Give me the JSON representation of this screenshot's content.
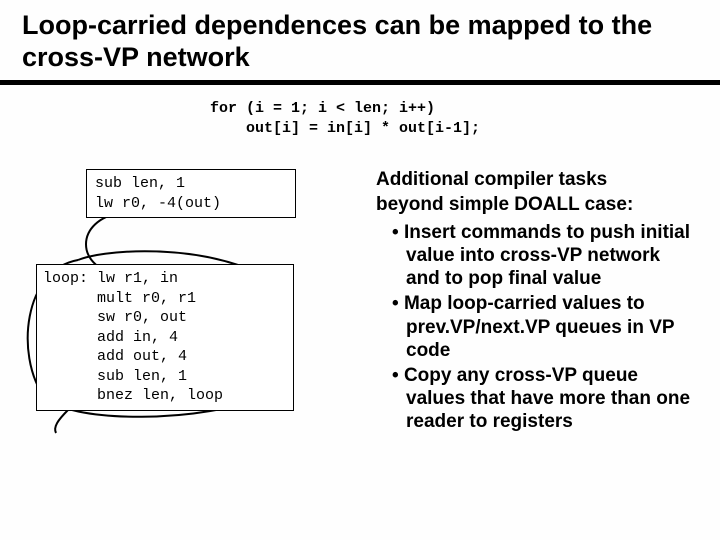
{
  "title": "Loop-carried dependences can be mapped to the cross-VP network",
  "forcode": "for (i = 1; i < len; i++)\n    out[i] = in[i] * out[i-1];",
  "box1": "sub len, 1\nlw r0, -4(out)",
  "box2": "loop: lw r1, in\n      mult r0, r1\n      sw r0, out\n      add in, 4\n      add out, 4\n      sub len, 1\n      bnez len, loop",
  "right_heading": "Additional compiler tasks",
  "right_sub": "beyond simple DOALL case:",
  "bullets": [
    "Insert commands to push initial value into cross-VP network and to pop final value",
    "Map loop-carried values to prev.VP/next.VP queues in VP code",
    "Copy any cross-VP queue values that have more than one reader to registers"
  ]
}
